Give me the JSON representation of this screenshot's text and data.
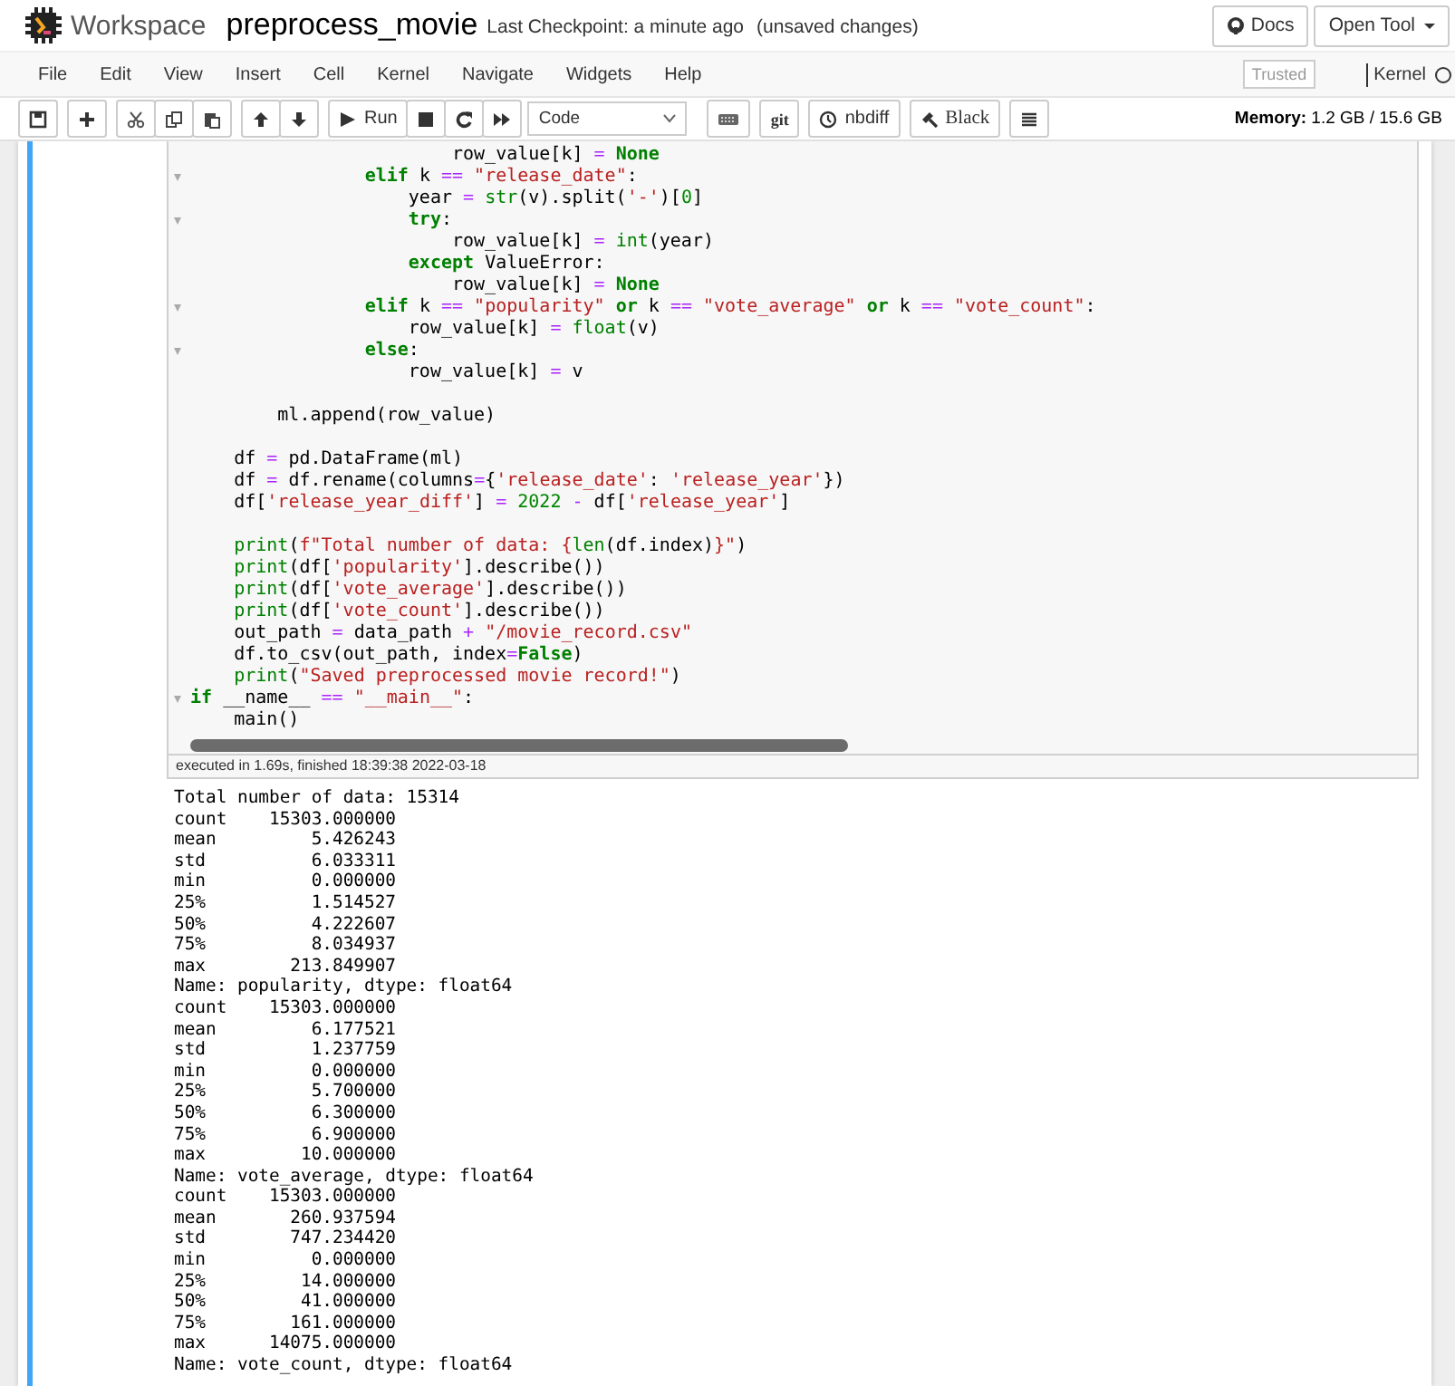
{
  "header": {
    "app_name": "Workspace",
    "notebook_name": "preprocess_movie",
    "checkpoint": "Last Checkpoint: a minute ago",
    "unsaved": "(unsaved changes)",
    "docs_button": "Docs",
    "tool_menu": "Open Tool"
  },
  "menu": [
    "File",
    "Edit",
    "View",
    "Insert",
    "Cell",
    "Kernel",
    "Navigate",
    "Widgets",
    "Help"
  ],
  "trusted": "Trusted",
  "kernel": "Kernel",
  "kernel_busy": false,
  "toolbar": {
    "run": "Run",
    "cell_type": "Code",
    "git": "git",
    "nbdiff": "nbdiff",
    "black": "Black",
    "memory": "**Memory:** 1.2 GB / 15.6 GB"
  },
  "cell": {
    "selected": true,
    "code_lines": [
      {
        "kind": "code",
        "foldable": false,
        "tokens": [
          {
            "kind": "plain",
            "text": "                        row_value[k] "
          },
          {
            "kind": "operator",
            "text": "= "
          },
          {
            "kind": "keyword",
            "text": "None"
          }
        ]
      },
      {
        "kind": "code",
        "foldable": true,
        "tokens": [
          {
            "kind": "keyword",
            "text": "                elif"
          },
          {
            "kind": "plain",
            "text": " k "
          },
          {
            "kind": "operator",
            "text": "== "
          },
          {
            "kind": "string",
            "text": "\"release_date\""
          },
          {
            "kind": "plain",
            "text": ":"
          }
        ]
      },
      {
        "kind": "code",
        "foldable": false,
        "tokens": [
          {
            "kind": "plain",
            "text": "                    year "
          },
          {
            "kind": "operator",
            "text": "= "
          },
          {
            "kind": "builtin",
            "text": "str"
          },
          {
            "kind": "plain",
            "text": "(v).split("
          },
          {
            "kind": "string",
            "text": "'-'"
          },
          {
            "kind": "plain",
            "text": ")["
          },
          {
            "kind": "number",
            "text": "0"
          },
          {
            "kind": "plain",
            "text": "]"
          }
        ]
      },
      {
        "kind": "code",
        "foldable": true,
        "tokens": [
          {
            "kind": "keyword",
            "text": "                    try"
          },
          {
            "kind": "plain",
            "text": ":"
          }
        ]
      },
      {
        "kind": "code",
        "foldable": false,
        "tokens": [
          {
            "kind": "plain",
            "text": "                        row_value[k] "
          },
          {
            "kind": "operator",
            "text": "= "
          },
          {
            "kind": "builtin",
            "text": "int"
          },
          {
            "kind": "plain",
            "text": "(year)"
          }
        ]
      },
      {
        "kind": "code",
        "foldable": false,
        "tokens": [
          {
            "kind": "keyword",
            "text": "                    except"
          },
          {
            "kind": "plain",
            "text": " ValueError:"
          }
        ]
      },
      {
        "kind": "code",
        "foldable": false,
        "tokens": [
          {
            "kind": "plain",
            "text": "                        row_value[k] "
          },
          {
            "kind": "operator",
            "text": "= "
          },
          {
            "kind": "keyword",
            "text": "None"
          }
        ]
      },
      {
        "kind": "code",
        "foldable": true,
        "tokens": [
          {
            "kind": "keyword",
            "text": "                elif"
          },
          {
            "kind": "plain",
            "text": " k "
          },
          {
            "kind": "operator",
            "text": "== "
          },
          {
            "kind": "string",
            "text": "\"popularity\" "
          },
          {
            "kind": "keyword",
            "text": "or"
          },
          {
            "kind": "plain",
            "text": " k "
          },
          {
            "kind": "operator",
            "text": "== "
          },
          {
            "kind": "string",
            "text": "\"vote_average\" "
          },
          {
            "kind": "keyword",
            "text": "or"
          },
          {
            "kind": "plain",
            "text": " k "
          },
          {
            "kind": "operator",
            "text": "== "
          },
          {
            "kind": "string",
            "text": "\"vote_count\""
          },
          {
            "kind": "plain",
            "text": ":"
          }
        ]
      },
      {
        "kind": "code",
        "foldable": false,
        "tokens": [
          {
            "kind": "plain",
            "text": "                    row_value[k] "
          },
          {
            "kind": "operator",
            "text": "= "
          },
          {
            "kind": "builtin",
            "text": "float"
          },
          {
            "kind": "plain",
            "text": "(v)"
          }
        ]
      },
      {
        "kind": "code",
        "foldable": true,
        "tokens": [
          {
            "kind": "keyword",
            "text": "                else"
          },
          {
            "kind": "plain",
            "text": ":"
          }
        ]
      },
      {
        "kind": "code",
        "foldable": false,
        "tokens": [
          {
            "kind": "plain",
            "text": "                    row_value[k] "
          },
          {
            "kind": "operator",
            "text": "="
          },
          {
            "kind": "plain",
            "text": " v"
          }
        ]
      },
      {
        "kind": "blank",
        "foldable": false
      },
      {
        "kind": "code",
        "foldable": false,
        "tokens": [
          {
            "kind": "plain",
            "text": "        ml.append(row_value)"
          }
        ]
      },
      {
        "kind": "blank",
        "foldable": false
      },
      {
        "kind": "code",
        "foldable": false,
        "tokens": [
          {
            "kind": "plain",
            "text": "    df "
          },
          {
            "kind": "operator",
            "text": "="
          },
          {
            "kind": "plain",
            "text": " pd.DataFrame(ml)"
          }
        ]
      },
      {
        "kind": "code",
        "foldable": false,
        "tokens": [
          {
            "kind": "plain",
            "text": "    df "
          },
          {
            "kind": "operator",
            "text": "="
          },
          {
            "kind": "plain",
            "text": " df.rename(columns"
          },
          {
            "kind": "operator",
            "text": "="
          },
          {
            "kind": "plain",
            "text": "{"
          },
          {
            "kind": "string",
            "text": "'release_date'"
          },
          {
            "kind": "plain",
            "text": ": "
          },
          {
            "kind": "string",
            "text": "'release_year'"
          },
          {
            "kind": "plain",
            "text": "})"
          }
        ]
      },
      {
        "kind": "code",
        "foldable": false,
        "tokens": [
          {
            "kind": "plain",
            "text": "    df["
          },
          {
            "kind": "string",
            "text": "'release_year_diff'"
          },
          {
            "kind": "plain",
            "text": "] "
          },
          {
            "kind": "operator",
            "text": "= "
          },
          {
            "kind": "number",
            "text": "2022 "
          },
          {
            "kind": "operator",
            "text": "-"
          },
          {
            "kind": "plain",
            "text": " df["
          },
          {
            "kind": "string",
            "text": "'release_year'"
          },
          {
            "kind": "plain",
            "text": "]"
          }
        ]
      },
      {
        "kind": "blank",
        "foldable": false
      },
      {
        "kind": "code",
        "foldable": false,
        "tokens": [
          {
            "kind": "builtin",
            "text": "    print"
          },
          {
            "kind": "plain",
            "text": "("
          },
          {
            "kind": "string",
            "text": "f\"Total number of data: {"
          },
          {
            "kind": "builtin",
            "text": "len"
          },
          {
            "kind": "plain",
            "text": "(df.index)"
          },
          {
            "kind": "string",
            "text": "}\""
          },
          {
            "kind": "plain",
            "text": ")"
          }
        ]
      },
      {
        "kind": "code",
        "foldable": false,
        "tokens": [
          {
            "kind": "builtin",
            "text": "    print"
          },
          {
            "kind": "plain",
            "text": "(df["
          },
          {
            "kind": "string",
            "text": "'popularity'"
          },
          {
            "kind": "plain",
            "text": "].describe())"
          }
        ]
      },
      {
        "kind": "code",
        "foldable": false,
        "tokens": [
          {
            "kind": "builtin",
            "text": "    print"
          },
          {
            "kind": "plain",
            "text": "(df["
          },
          {
            "kind": "string",
            "text": "'vote_average'"
          },
          {
            "kind": "plain",
            "text": "].describe())"
          }
        ]
      },
      {
        "kind": "code",
        "foldable": false,
        "tokens": [
          {
            "kind": "builtin",
            "text": "    print"
          },
          {
            "kind": "plain",
            "text": "(df["
          },
          {
            "kind": "string",
            "text": "'vote_count'"
          },
          {
            "kind": "plain",
            "text": "].describe())"
          }
        ]
      },
      {
        "kind": "code",
        "foldable": false,
        "tokens": [
          {
            "kind": "plain",
            "text": "    out_path "
          },
          {
            "kind": "operator",
            "text": "="
          },
          {
            "kind": "plain",
            "text": " data_path "
          },
          {
            "kind": "operator",
            "text": "+ "
          },
          {
            "kind": "string",
            "text": "\"/movie_record.csv\""
          }
        ]
      },
      {
        "kind": "code",
        "foldable": false,
        "tokens": [
          {
            "kind": "plain",
            "text": "    df.to_csv(out_path, index"
          },
          {
            "kind": "operator",
            "text": "="
          },
          {
            "kind": "keyword",
            "text": "False"
          },
          {
            "kind": "plain",
            "text": ")"
          }
        ]
      },
      {
        "kind": "code",
        "foldable": false,
        "tokens": [
          {
            "kind": "builtin",
            "text": "    print"
          },
          {
            "kind": "plain",
            "text": "("
          },
          {
            "kind": "string",
            "text": "\"Saved preprocessed movie record!\""
          },
          {
            "kind": "plain",
            "text": ")"
          }
        ]
      },
      {
        "kind": "code",
        "foldable": true,
        "tokens": [
          {
            "kind": "keyword",
            "text": "if"
          },
          {
            "kind": "plain",
            "text": " __name__ "
          },
          {
            "kind": "operator",
            "text": "== "
          },
          {
            "kind": "string",
            "text": "\"__main__\""
          },
          {
            "kind": "plain",
            "text": ":"
          }
        ]
      },
      {
        "kind": "code",
        "foldable": false,
        "tokens": [
          {
            "kind": "plain",
            "text": "    main()"
          }
        ]
      }
    ],
    "execution_info": "executed in 1.69s, finished 18:39:38 2022-03-18",
    "output_lines": [
      "Total number of data: 15314",
      "count    15303.000000",
      "mean         5.426243",
      "std          6.033311",
      "min          0.000000",
      "25%          1.514527",
      "50%          4.222607",
      "75%          8.034937",
      "max        213.849907",
      "Name: popularity, dtype: float64",
      "count    15303.000000",
      "mean         6.177521",
      "std          1.237759",
      "min          0.000000",
      "25%          5.700000",
      "50%          6.300000",
      "75%          6.900000",
      "max         10.000000",
      "Name: vote_average, dtype: float64",
      "count    15303.000000",
      "mean       260.937594",
      "std        747.234420",
      "min          0.000000",
      "25%         14.000000",
      "50%         41.000000",
      "75%        161.000000",
      "max      14075.000000",
      "Name: vote_count, dtype: float64"
    ]
  }
}
